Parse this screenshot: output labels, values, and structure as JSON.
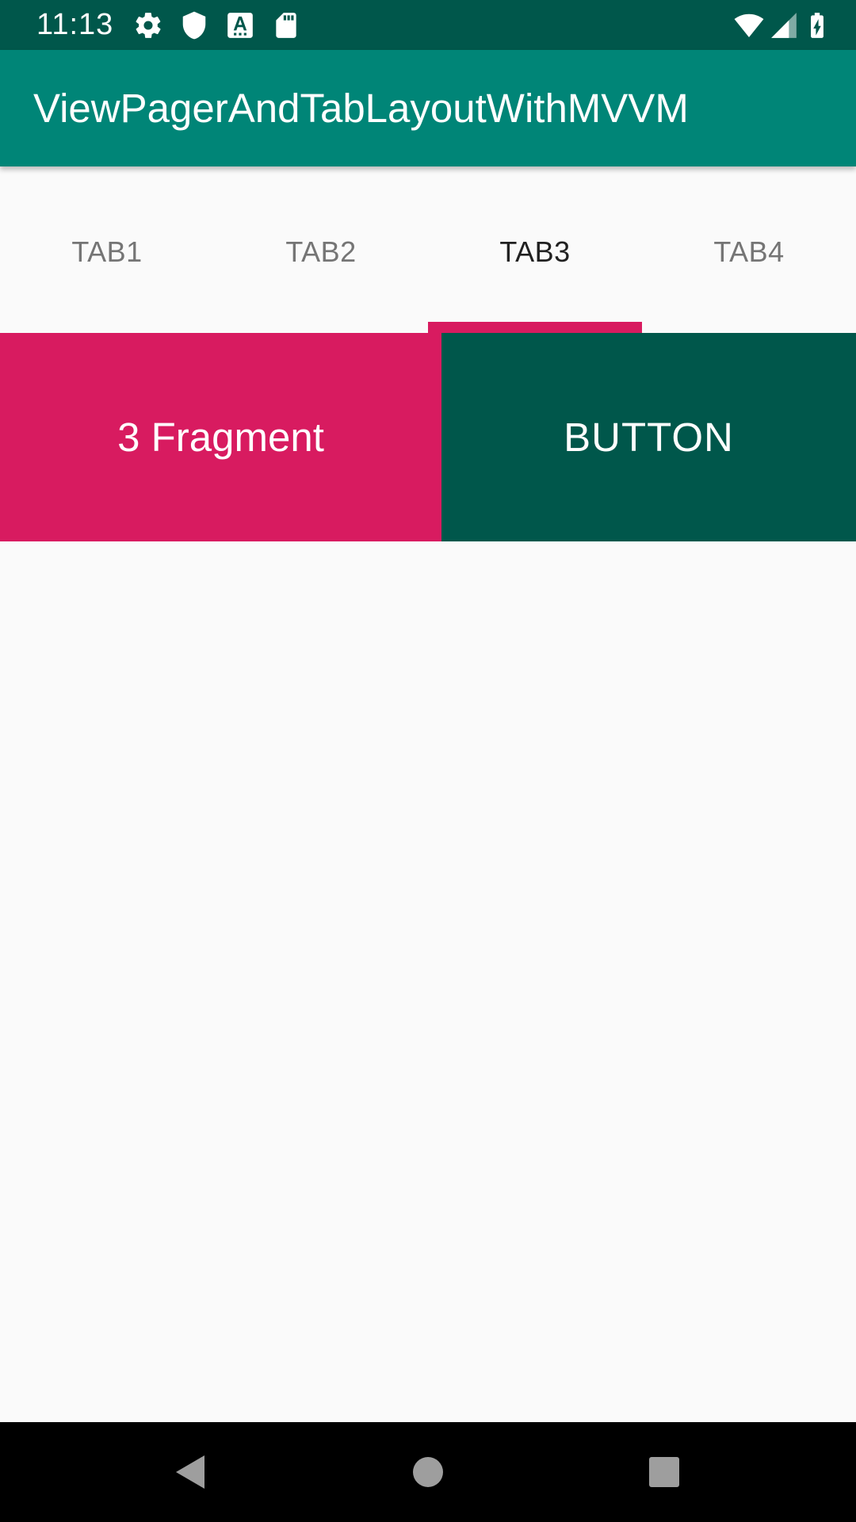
{
  "status_bar": {
    "time": "11:13",
    "icons": [
      "settings-icon",
      "shield-icon",
      "font-a-icon",
      "sd-card-icon",
      "wifi-icon",
      "signal-icon",
      "battery-charging-icon"
    ],
    "background_color": "#00574b"
  },
  "app_bar": {
    "title": "ViewPagerAndTabLayoutWithMVVM",
    "background_color": "#008577"
  },
  "tabs": {
    "items": [
      {
        "label": "TAB1",
        "selected": false
      },
      {
        "label": "TAB2",
        "selected": false
      },
      {
        "label": "TAB3",
        "selected": true
      },
      {
        "label": "TAB4",
        "selected": false
      }
    ],
    "indicator_color": "#d81b60"
  },
  "fragment": {
    "label": "3 Fragment",
    "label_background": "#d81b60",
    "button_label": "BUTTON",
    "button_background": "#00574b"
  },
  "nav_bar": {
    "buttons": [
      "back-icon",
      "home-icon",
      "recents-icon"
    ]
  }
}
